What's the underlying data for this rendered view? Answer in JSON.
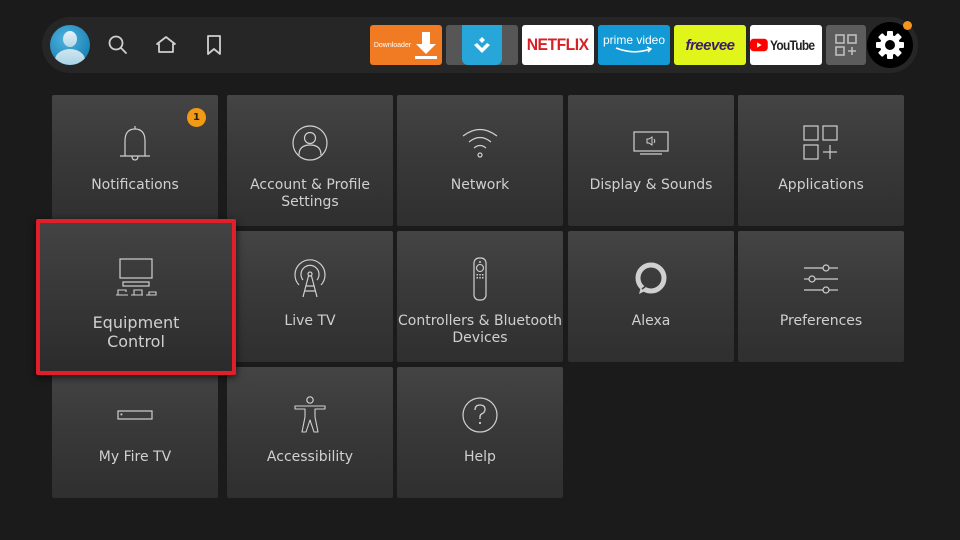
{
  "topbar": {
    "profile": {
      "name": "profile-avatar"
    },
    "nav": [
      {
        "id": "search",
        "icon": "search-icon"
      },
      {
        "id": "home",
        "icon": "home-icon"
      },
      {
        "id": "watchlist",
        "icon": "bookmark-icon"
      }
    ],
    "apps": [
      {
        "id": "downloader",
        "label": "Downloader",
        "color": "#f07b22"
      },
      {
        "id": "appstore",
        "label": "",
        "color": "#26a6d9"
      },
      {
        "id": "netflix",
        "label": "NETFLIX",
        "color": "#d81f26"
      },
      {
        "id": "prime-video",
        "label": "prime video",
        "color": "#1399d6"
      },
      {
        "id": "freevee",
        "label": "freevee",
        "color": "#e0f51a"
      },
      {
        "id": "youtube",
        "label": "YouTube",
        "color": "#ff0000"
      },
      {
        "id": "all-apps",
        "label": ""
      }
    ],
    "settings": {
      "icon": "gear-icon",
      "notification_dot_color": "#f7941d"
    }
  },
  "tiles": [
    {
      "id": "notifications",
      "label": "Notifications",
      "icon": "bell-icon",
      "badge": "1"
    },
    {
      "id": "account",
      "label": "Account & Profile Settings",
      "icon": "user-circle-icon"
    },
    {
      "id": "network",
      "label": "Network",
      "icon": "wifi-icon"
    },
    {
      "id": "display-sounds",
      "label": "Display & Sounds",
      "icon": "tv-speaker-icon"
    },
    {
      "id": "applications",
      "label": "Applications",
      "icon": "apps-grid-icon"
    },
    {
      "id": "equipment-control",
      "label": "Equipment Control",
      "icon": "equipment-icon",
      "focused": true
    },
    {
      "id": "live-tv",
      "label": "Live TV",
      "icon": "antenna-icon"
    },
    {
      "id": "controllers",
      "label": "Controllers & Bluetooth Devices",
      "icon": "remote-icon"
    },
    {
      "id": "alexa",
      "label": "Alexa",
      "icon": "alexa-icon"
    },
    {
      "id": "preferences",
      "label": "Preferences",
      "icon": "sliders-icon"
    },
    {
      "id": "my-fire-tv",
      "label": "My Fire TV",
      "icon": "fire-tv-stick-icon"
    },
    {
      "id": "accessibility",
      "label": "Accessibility",
      "icon": "accessibility-icon"
    },
    {
      "id": "help",
      "label": "Help",
      "icon": "help-icon"
    }
  ],
  "theme": {
    "focus_color": "#e01f2a",
    "badge_color": "#f29a13"
  }
}
